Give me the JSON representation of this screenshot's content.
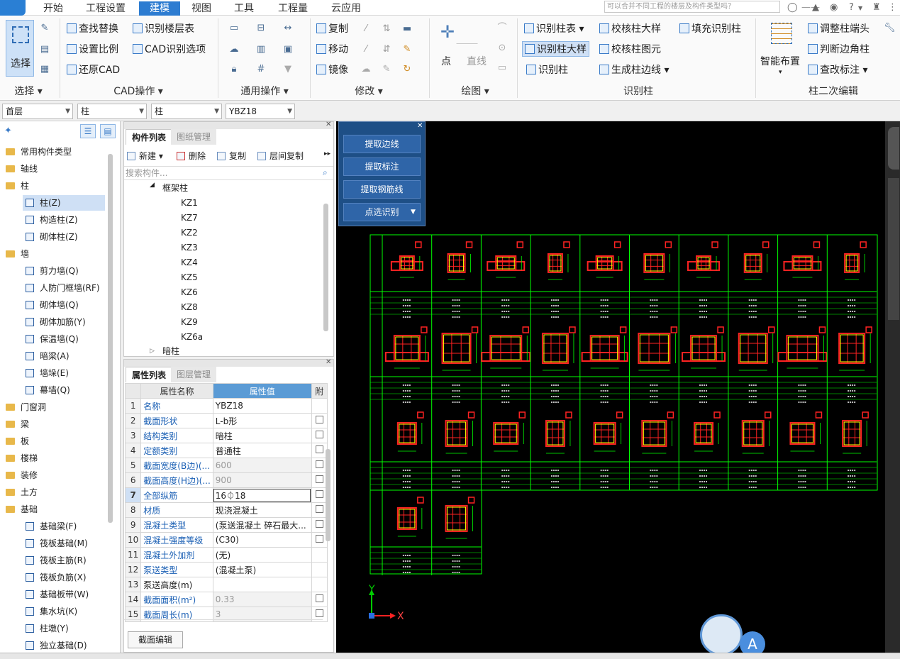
{
  "menubar": {
    "items": [
      "开始",
      "工程设置",
      "建模",
      "视图",
      "工具",
      "工程量",
      "云应用"
    ],
    "active": "建模",
    "search_placeholder": "可以合并不同工程的楼层及构件类型吗？"
  },
  "ribbon": {
    "select_label": "选择",
    "groups": {
      "select": "选择",
      "cad": "CAD操作",
      "general": "通用操作",
      "modify": "修改",
      "draw": "绘图",
      "identify": "识别柱",
      "secondary": "柱二次编辑"
    },
    "cad_buttons": [
      "查找替换",
      "识别楼层表",
      "设置比例",
      "CAD识别选项",
      "还原CAD"
    ],
    "modify_buttons": [
      "复制",
      "移动",
      "镜像"
    ],
    "draw_buttons": [
      "点",
      "直线"
    ],
    "identify_buttons": [
      "识别柱表",
      "校核柱大样",
      "填充识别柱",
      "识别柱大样",
      "校核柱图元",
      "识别柱",
      "生成柱边线"
    ],
    "smart_layout": "智能布置",
    "secondary_buttons": [
      "调整柱端头",
      "判断边角柱",
      "查改标注"
    ]
  },
  "selectors": {
    "floor": "首层",
    "type": "柱",
    "subtype": "柱",
    "component": "YBZ18"
  },
  "tree": {
    "categories": [
      {
        "label": "常用构件类型"
      },
      {
        "label": "轴线"
      },
      {
        "label": "柱",
        "children": [
          "柱(Z)",
          "构造柱(Z)",
          "砌体柱(Z)"
        ]
      },
      {
        "label": "墙",
        "children": [
          "剪力墙(Q)",
          "人防门框墙(RF)",
          "砌体墙(Q)",
          "砌体加筋(Y)",
          "保温墙(Q)",
          "暗梁(A)",
          "墙垛(E)",
          "幕墙(Q)"
        ]
      },
      {
        "label": "门窗洞"
      },
      {
        "label": "梁"
      },
      {
        "label": "板"
      },
      {
        "label": "楼梯"
      },
      {
        "label": "装修"
      },
      {
        "label": "土方"
      },
      {
        "label": "基础",
        "children": [
          "基础梁(F)",
          "筏板基础(M)",
          "筏板主筋(R)",
          "筏板负筋(X)",
          "基础板带(W)",
          "集水坑(K)",
          "柱墩(Y)",
          "独立基础(D)"
        ]
      }
    ],
    "selected": "柱(Z)"
  },
  "component_list": {
    "tab_active": "构件列表",
    "tab_inactive": "图纸管理",
    "toolbar": [
      "新建",
      "删除",
      "复制",
      "层间复制"
    ],
    "search_placeholder": "搜索构件...",
    "group": "框架柱",
    "items": [
      "KZ1",
      "KZ7",
      "KZ2",
      "KZ3",
      "KZ4",
      "KZ5",
      "KZ6",
      "KZ8",
      "KZ9",
      "KZ6a"
    ],
    "collapsed_group": "暗柱"
  },
  "attributes": {
    "tab_active": "属性列表",
    "tab_inactive": "图层管理",
    "headers": [
      "属性名称",
      "属性值",
      "附"
    ],
    "rows": [
      {
        "n": "1",
        "name": "名称",
        "value": "YBZ18",
        "gray": false,
        "blue": true,
        "chk": false
      },
      {
        "n": "2",
        "name": "截面形状",
        "value": "L-b形",
        "gray": false,
        "blue": true,
        "chk": true
      },
      {
        "n": "3",
        "name": "结构类别",
        "value": "暗柱",
        "gray": false,
        "blue": true,
        "chk": true
      },
      {
        "n": "4",
        "name": "定额类别",
        "value": "普通柱",
        "gray": false,
        "blue": true,
        "chk": true
      },
      {
        "n": "5",
        "name": "截面宽度(B边)(...",
        "value": "600",
        "gray": true,
        "blue": true,
        "chk": true
      },
      {
        "n": "6",
        "name": "截面高度(H边)(...",
        "value": "900",
        "gray": true,
        "blue": true,
        "chk": true
      },
      {
        "n": "7",
        "name": "全部纵筋",
        "value": "16⏀18",
        "gray": false,
        "blue": true,
        "chk": true
      },
      {
        "n": "8",
        "name": "材质",
        "value": "现浇混凝土",
        "gray": false,
        "blue": true,
        "chk": true
      },
      {
        "n": "9",
        "name": "混凝土类型",
        "value": "(泵送混凝土 碎石最大...",
        "gray": false,
        "blue": true,
        "chk": true
      },
      {
        "n": "10",
        "name": "混凝土强度等级",
        "value": "(C30)",
        "gray": false,
        "blue": true,
        "chk": true
      },
      {
        "n": "11",
        "name": "混凝土外加剂",
        "value": "(无)",
        "gray": false,
        "blue": true,
        "chk": false
      },
      {
        "n": "12",
        "name": "泵送类型",
        "value": "(混凝土泵)",
        "gray": false,
        "blue": true,
        "chk": false
      },
      {
        "n": "13",
        "name": "泵送高度(m)",
        "value": "",
        "gray": false,
        "blue": false,
        "chk": false
      },
      {
        "n": "14",
        "name": "截面面积(m²)",
        "value": "0.33",
        "gray": true,
        "blue": true,
        "chk": true
      },
      {
        "n": "15",
        "name": "截面周长(m)",
        "value": "3",
        "gray": true,
        "blue": true,
        "chk": true
      }
    ],
    "section_edit": "截面编辑"
  },
  "extract_panel": {
    "buttons": [
      "提取边线",
      "提取标注",
      "提取钢筋线",
      "点选识别"
    ]
  },
  "canvas": {
    "axis_x": "X",
    "axis_y": "Y",
    "line_color": "#00ff00",
    "section_color": "#ff2222",
    "rebar_color": "#ffff00"
  },
  "assistant_badge": "A"
}
